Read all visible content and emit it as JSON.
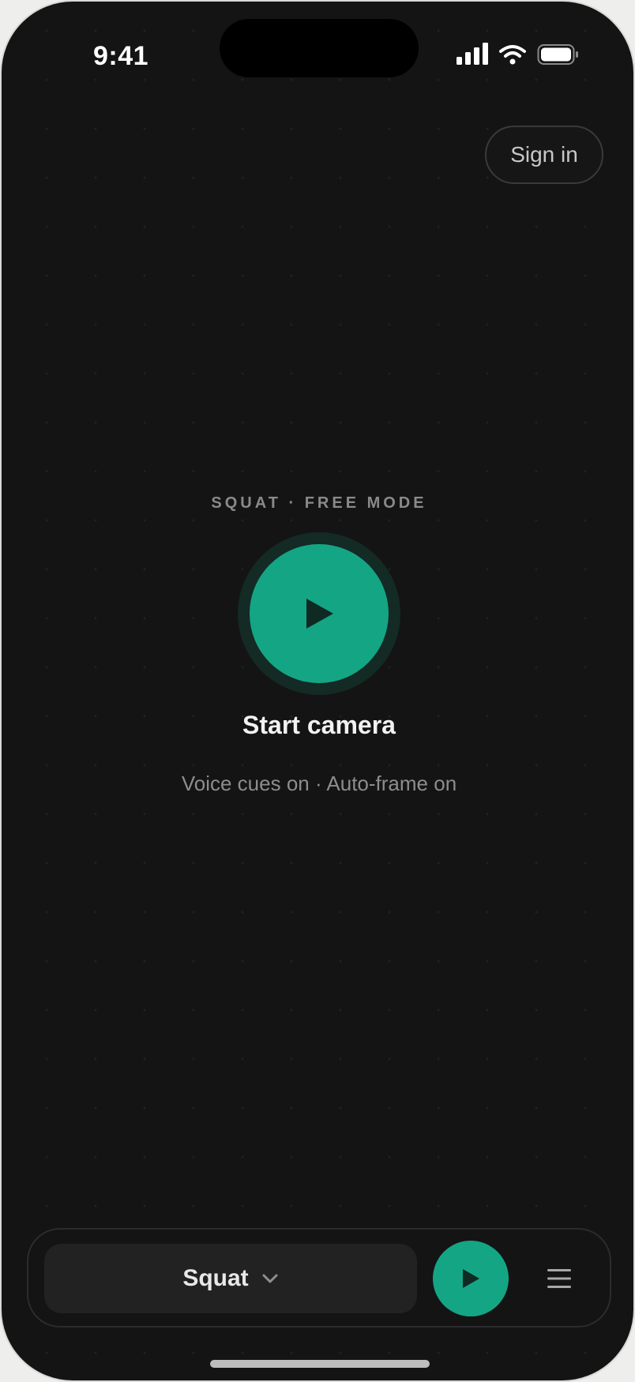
{
  "status_bar": {
    "time": "9:41",
    "icons": [
      "signal-icon",
      "wifi-icon",
      "battery-icon"
    ]
  },
  "header": {
    "sign_in_label": "Sign in"
  },
  "hero": {
    "mode_label": "SQUAT · FREE MODE",
    "start_icon": "play-icon",
    "start_title": "Start camera",
    "start_subtitle": "Voice cues on · Auto-frame on"
  },
  "bottom_bar": {
    "exercise_selected": "Squat",
    "dropdown_icon": "chevron-down-icon",
    "play_icon": "play-icon",
    "menu_icon": "menu-icon"
  },
  "colors": {
    "background": "#141414",
    "accent": "#14a584",
    "text_primary": "#f2f2f2",
    "text_secondary": "#8d8d8d"
  }
}
